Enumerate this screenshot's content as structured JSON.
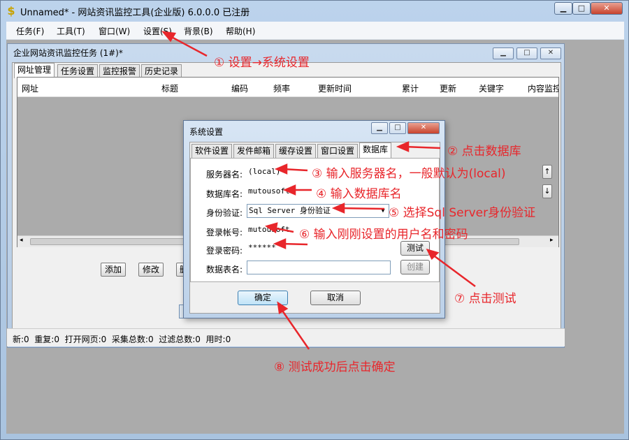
{
  "window": {
    "title": "Unnamed* - 网站资讯监控工具(企业版) 6.0.0.0 已注册",
    "icon": "$",
    "btn_min": "▁",
    "btn_max": "□",
    "btn_close": "✕"
  },
  "menubar": [
    "任务(F)",
    "工具(T)",
    "窗口(W)",
    "设置(S)",
    "背景(B)",
    "帮助(H)"
  ],
  "task_window": {
    "title": "企业网站资讯监控任务 (1#)*",
    "tabs": [
      "网址管理",
      "任务设置",
      "监控报警",
      "历史记录"
    ],
    "columns": [
      "网址",
      "标题",
      "编码",
      "频率",
      "更新时间",
      "累计",
      "更新",
      "关键字",
      "内容监控"
    ],
    "buttons": [
      "添加",
      "修改",
      "删"
    ]
  },
  "status_bar": "新:0  重复:0  打开网页:0  采集总数:0  过滤总数:0  用时:0",
  "dialog": {
    "title": "系统设置",
    "tabs": [
      "软件设置",
      "发件邮箱",
      "缓存设置",
      "窗口设置",
      "数据库"
    ],
    "labels": {
      "server": "服务器名:",
      "database": "数据库名:",
      "auth": "身份验证:",
      "login": "登录帐号:",
      "password": "登录密码:",
      "table": "数据表名:"
    },
    "values": {
      "server": "(local)",
      "database": "mutousoft",
      "auth": "Sql Server 身份验证",
      "login": "mutousoft",
      "password": "******",
      "table": ""
    },
    "btn_test": "测试",
    "btn_create": "创建",
    "btn_ok": "确定",
    "btn_cancel": "取消",
    "side_up": "↑",
    "side_down": "↓"
  },
  "annotations": [
    "① 设置→系统设置",
    "② 点击数据库",
    "③ 输入服务器名，一般默认为(local)",
    "④ 输入数据库名",
    "⑤ 选择Sql Server身份验证",
    "⑥ 输入刚刚设置的用户名和密码",
    "⑦ 点击测试",
    "⑧ 测试成功后点击确定"
  ],
  "colors": {
    "annotation": "#e8262b",
    "titlebar": "#bcd3ec",
    "mdi": "#ababab"
  }
}
